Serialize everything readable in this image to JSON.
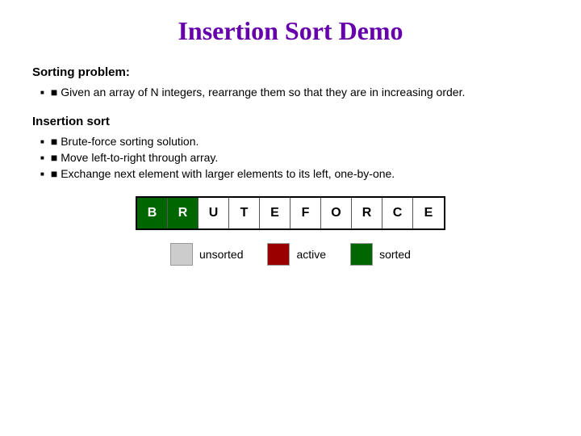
{
  "title": "Insertion Sort Demo",
  "sorting_problem": {
    "heading": "Sorting problem:",
    "bullets": [
      "Given an array of N integers, rearrange them so that they are in increasing order."
    ]
  },
  "insertion_sort": {
    "heading": "Insertion sort",
    "bullets": [
      "Brute-force sorting solution.",
      "Move left-to-right through array.",
      "Exchange next element with larger elements to its left, one-by-one."
    ]
  },
  "array": {
    "cells": [
      {
        "letter": "B",
        "state": "sorted"
      },
      {
        "letter": "R",
        "state": "sorted"
      },
      {
        "letter": "U",
        "state": "unsorted"
      },
      {
        "letter": "T",
        "state": "unsorted"
      },
      {
        "letter": "E",
        "state": "unsorted"
      },
      {
        "letter": "F",
        "state": "unsorted"
      },
      {
        "letter": "O",
        "state": "unsorted"
      },
      {
        "letter": "R",
        "state": "unsorted"
      },
      {
        "letter": "C",
        "state": "unsorted"
      },
      {
        "letter": "E",
        "state": "unsorted"
      }
    ]
  },
  "legend": {
    "unsorted_label": "unsorted",
    "active_label": "active",
    "sorted_label": "sorted"
  }
}
